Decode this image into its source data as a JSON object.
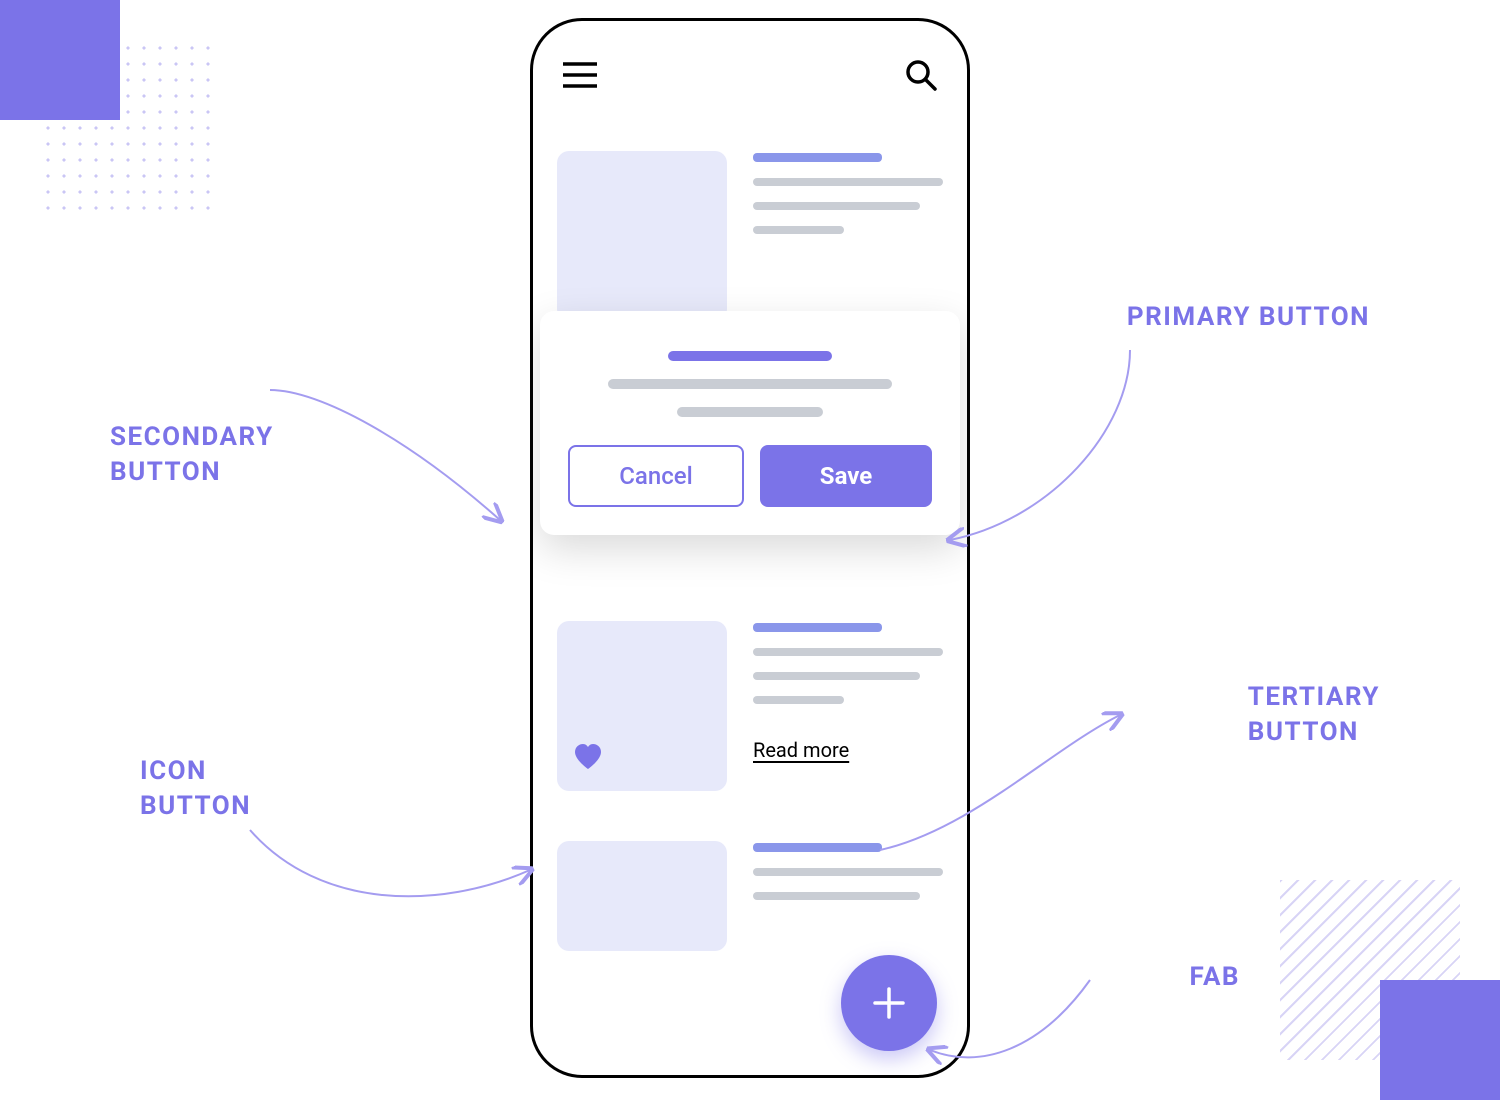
{
  "annotations": {
    "primary": "PRIMARY BUTTON",
    "secondary": "SECONDARY\nBUTTON",
    "icon": "ICON\nBUTTON",
    "tertiary": "TERTIARY\nBUTTON",
    "fab": "FAB"
  },
  "dialog": {
    "cancel_label": "Cancel",
    "save_label": "Save"
  },
  "card": {
    "read_more_label": "Read more"
  },
  "icons": {
    "hamburger": "hamburger-icon",
    "search": "search-icon",
    "heart": "heart-icon",
    "plus": "plus-icon"
  },
  "colors": {
    "accent": "#7b73e8",
    "thumb_bg": "#e7e9fa",
    "grey": "#c9cdd4"
  }
}
